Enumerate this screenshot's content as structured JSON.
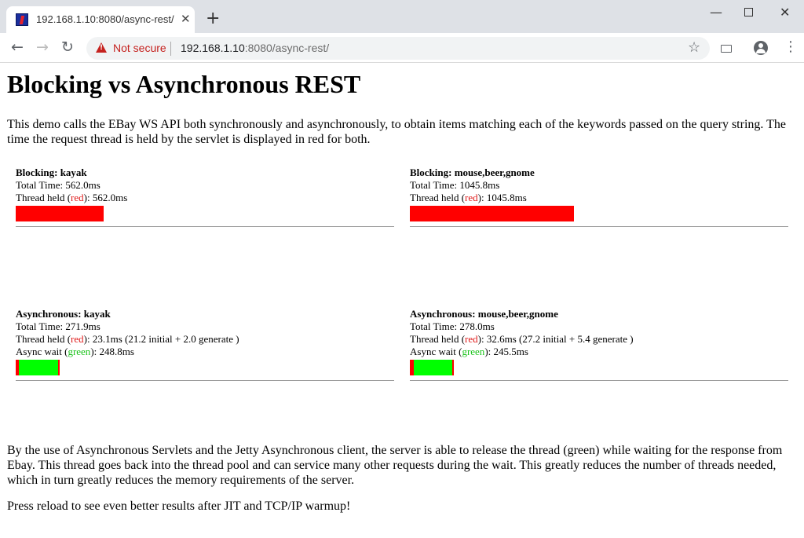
{
  "browser": {
    "tab_title": "192.168.1.10:8080/async-rest/",
    "close_glyph": "✕",
    "new_tab_glyph": "+",
    "security_label": "Not secure",
    "url_host": "192.168.1.10",
    "url_rest": ":8080/async-rest/",
    "icons": [
      "favicon",
      "close-icon",
      "plus-icon",
      "minimize-icon",
      "maximize-icon",
      "window-close-icon",
      "back-arrow-icon",
      "forward-arrow-icon",
      "reload-icon",
      "warning-icon",
      "star-icon",
      "cast-icon",
      "account-icon",
      "menu-icon"
    ]
  },
  "page": {
    "title": "Blocking vs Asynchronous REST",
    "intro": "This demo calls the EBay WS API both synchronously and asynchronously, to obtain items matching each of the keywords passed on the query string. The time the request thread is held by the servlet is displayed in red for both.",
    "outro": "By the use of Asynchronous Servlets and the Jetty Asynchronous client, the server is able to release the thread (green) while waiting for the response from Ebay. This thread goes back into the thread pool and can service many other requests during the wait. This greatly reduces the number of threads needed, which in turn greatly reduces the memory requirements of the server.",
    "reload_note": "Press reload to see even better results after JIT and TCP/IP warmup!"
  },
  "panels": {
    "blocking_kayak": {
      "title": "Blocking: kayak",
      "total_time": "Total Time: 562.0ms",
      "held_prefix": "Thread held (",
      "held_color_word": "red",
      "held_suffix": "): 562.0ms",
      "held_ms": 562.0
    },
    "blocking_multi": {
      "title": "Blocking: mouse,beer,gnome",
      "total_time": "Total Time: 1045.8ms",
      "held_prefix": "Thread held (",
      "held_color_word": "red",
      "held_suffix": "): 1045.8ms",
      "held_ms": 1045.8
    },
    "async_kayak": {
      "title": "Asynchronous: kayak",
      "total_time": "Total Time: 271.9ms",
      "held_prefix": "Thread held (",
      "held_color_word": "red",
      "held_suffix": "): 23.1ms (21.2 initial + 2.0 generate )",
      "wait_prefix": "Async wait (",
      "wait_color_word": "green",
      "wait_suffix": "): 248.8ms",
      "initial_ms": 21.2,
      "wait_ms": 248.8,
      "generate_ms": 2.0
    },
    "async_multi": {
      "title": "Asynchronous: mouse,beer,gnome",
      "total_time": "Total Time: 278.0ms",
      "held_prefix": "Thread held (",
      "held_color_word": "red",
      "held_suffix": "): 32.6ms (27.2 initial + 5.4 generate )",
      "wait_prefix": "Async wait (",
      "wait_color_word": "green",
      "wait_suffix": "): 245.5ms",
      "initial_ms": 27.2,
      "wait_ms": 245.5,
      "generate_ms": 5.4
    }
  },
  "colors": {
    "held": "#ff0000",
    "wait": "#00ff00",
    "not_secure": "#c5221f"
  }
}
